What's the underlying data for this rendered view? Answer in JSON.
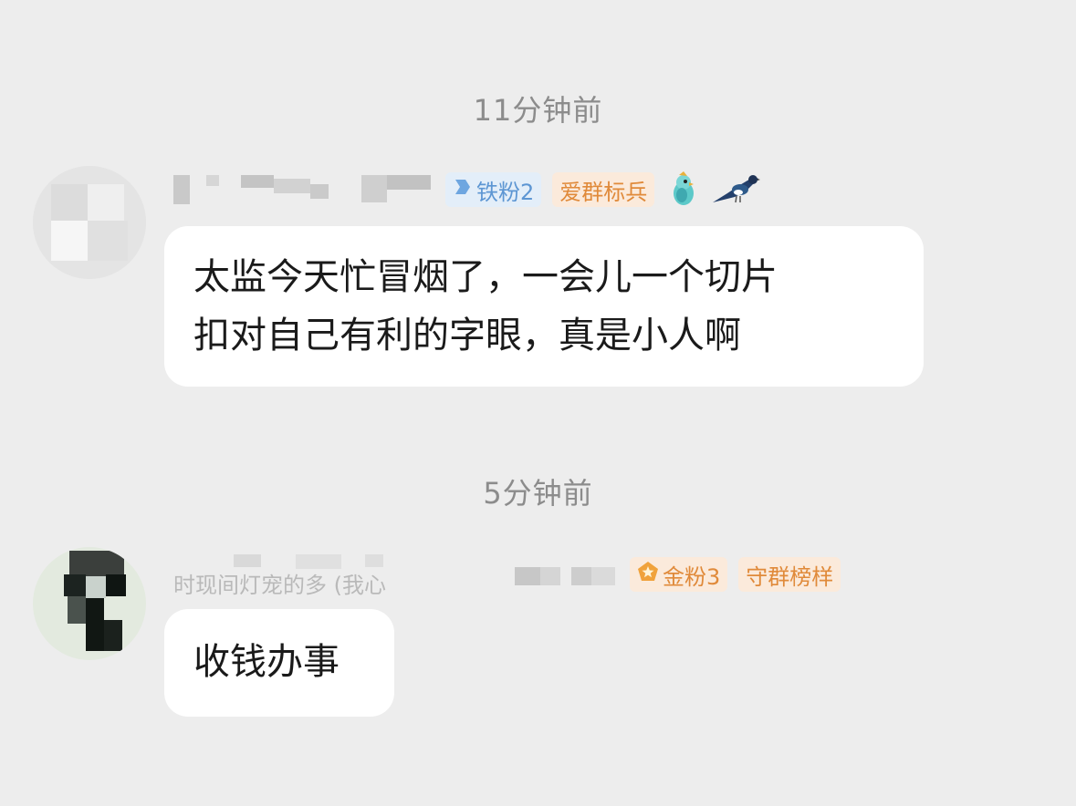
{
  "chat": {
    "messages": [
      {
        "timestamp": "11分钟前",
        "badges": {
          "fan_level": "铁粉2",
          "group_title": "爱群标兵"
        },
        "text_lines": [
          "太监今天忙冒烟了，一会儿一个切片",
          "扣对自己有利的字眼，真是小人啊"
        ]
      },
      {
        "timestamp": "5分钟前",
        "sender_name_partial": "时现间灯宠的多 (我心",
        "badges": {
          "fan_level": "金粉3",
          "group_title": "守群榜样"
        },
        "text_lines": [
          "收钱办事"
        ]
      }
    ]
  },
  "icons": {
    "iron_badge_icon": "arrow-shield-icon",
    "gold_badge_icon": "pentagon-star-icon",
    "decoration_1": "parrot-icon",
    "decoration_2": "magpie-icon"
  },
  "colors": {
    "background": "#ededed",
    "bubble": "#ffffff",
    "timestamp_text": "#8c8c8c",
    "iron_badge_text": "#5d96d3",
    "iron_badge_bg": "#e3eef9",
    "gold_badge_text": "#e08a3a",
    "gold_badge_bg": "#fbeadb"
  }
}
